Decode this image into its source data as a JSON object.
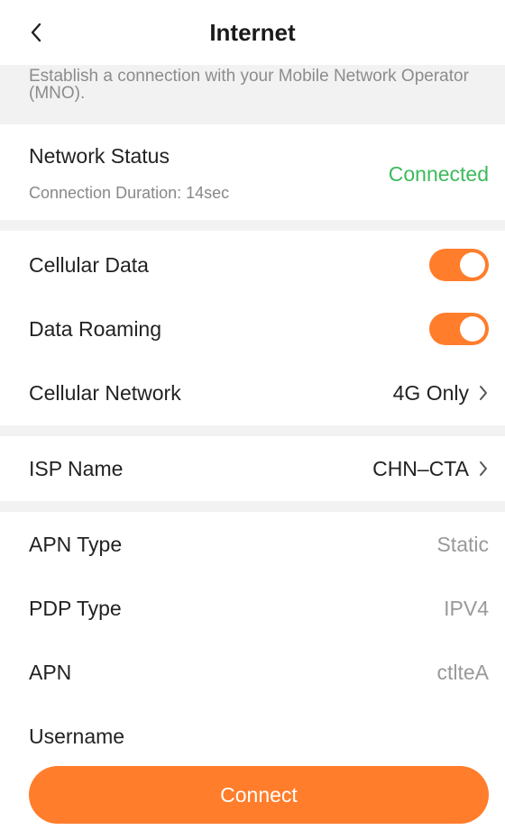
{
  "header": {
    "title": "Internet"
  },
  "description": "Establish a connection with your Mobile Network Operator (MNO).",
  "network_status": {
    "label": "Network Status",
    "duration": "Connection Duration: 14sec",
    "value": "Connected",
    "value_color": "#3dba5c"
  },
  "cellular": {
    "cellular_data_label": "Cellular Data",
    "cellular_data_on": true,
    "data_roaming_label": "Data Roaming",
    "data_roaming_on": true,
    "network_label": "Cellular Network",
    "network_value": "4G Only"
  },
  "isp": {
    "label": "ISP Name",
    "value": "CHN–CTA"
  },
  "apn": {
    "type_label": "APN Type",
    "type_value": "Static",
    "pdp_label": "PDP Type",
    "pdp_value": "IPV4",
    "apn_label": "APN",
    "apn_value": "ctlteA",
    "username_label": "Username"
  },
  "connect_button": "Connect",
  "colors": {
    "accent": "#ff7d2b",
    "connected": "#3dba5c"
  },
  "icons": {
    "back": "chevron-left-icon",
    "row_arrow": "chevron-right-icon"
  }
}
